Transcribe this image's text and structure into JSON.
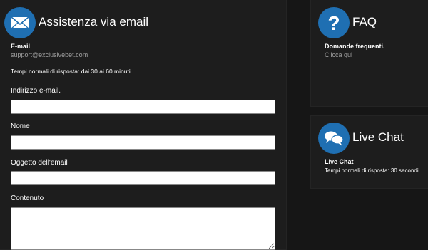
{
  "email_panel": {
    "title": "Assistenza via email",
    "icon": "envelope-icon",
    "email_label": "E-mail",
    "email_value": "support@exclusivebet.com",
    "response_time": "Tempi normali di risposta: dai 30 ai 60 minuti",
    "fields": {
      "address_label": "Indirizzo e-mail.",
      "address_value": "",
      "name_label": "Nome",
      "name_value": "",
      "subject_label": "Oggetto dell'email",
      "subject_value": "",
      "content_label": "Contenuto",
      "content_value": ""
    }
  },
  "faq_panel": {
    "title": "FAQ",
    "icon": "question-mark-icon",
    "subtitle": "Domande frequenti.",
    "link": "Clicca qui"
  },
  "chat_panel": {
    "title": "Live Chat",
    "icon": "chat-bubbles-icon",
    "subtitle": "Live Chat",
    "response_time": "Tempi normali di risposta: 30 secondi"
  },
  "colors": {
    "accent": "#1f6fb2",
    "background": "#161616",
    "panel": "#1d1d1d",
    "muted_text": "#a0a0a0"
  }
}
